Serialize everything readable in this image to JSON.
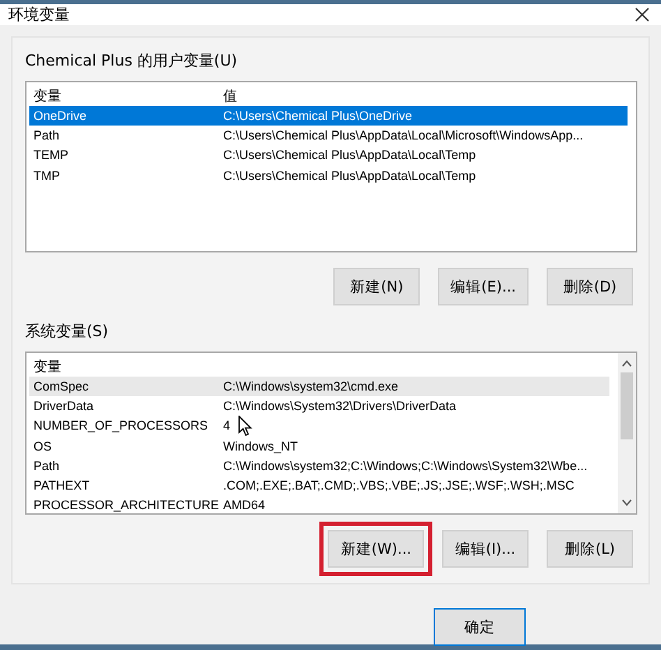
{
  "window": {
    "title": "环境变量"
  },
  "user_variables": {
    "label": "Chemical Plus 的用户变量(U)",
    "columns": [
      "变量",
      "值"
    ],
    "rows": [
      {
        "name": "OneDrive",
        "value": "C:\\Users\\Chemical Plus\\OneDrive",
        "selected": true,
        "hovered": false
      },
      {
        "name": "Path",
        "value": "C:\\Users\\Chemical Plus\\AppData\\Local\\Microsoft\\WindowsApp...",
        "selected": false,
        "hovered": false
      },
      {
        "name": "TEMP",
        "value": "C:\\Users\\Chemical Plus\\AppData\\Local\\Temp",
        "selected": false,
        "hovered": false
      },
      {
        "name": "TMP",
        "value": "C:\\Users\\Chemical Plus\\AppData\\Local\\Temp",
        "selected": false,
        "hovered": false
      }
    ],
    "buttons": [
      {
        "label": "新建(N)",
        "highlighted": false
      },
      {
        "label": "编辑(E)...",
        "highlighted": false
      },
      {
        "label": "删除(D)",
        "highlighted": false
      }
    ]
  },
  "system_variables": {
    "label": "系统变量(S)",
    "columns": [
      "变量"
    ],
    "rows": [
      {
        "name": "ComSpec",
        "value": "C:\\Windows\\system32\\cmd.exe",
        "selected": false,
        "hovered": true
      },
      {
        "name": "DriverData",
        "value": "C:\\Windows\\System32\\Drivers\\DriverData",
        "selected": false,
        "hovered": false
      },
      {
        "name": "NUMBER_OF_PROCESSORS",
        "value": "4",
        "selected": false,
        "hovered": false
      },
      {
        "name": "OS",
        "value": "Windows_NT",
        "selected": false,
        "hovered": false
      },
      {
        "name": "Path",
        "value": "C:\\Windows\\system32;C:\\Windows;C:\\Windows\\System32\\Wbe...",
        "selected": false,
        "hovered": false
      },
      {
        "name": "PATHEXT",
        "value": ".COM;.EXE;.BAT;.CMD;.VBS;.VBE;.JS;.JSE;.WSF;.WSH;.MSC",
        "selected": false,
        "hovered": false
      },
      {
        "name": "PROCESSOR_ARCHITECTURE",
        "value": "AMD64",
        "selected": false,
        "hovered": false
      }
    ],
    "buttons": [
      {
        "label": "新建(W)...",
        "highlighted": true
      },
      {
        "label": "编辑(I)...",
        "highlighted": false
      },
      {
        "label": "删除(L)",
        "highlighted": false
      }
    ]
  },
  "footer": {
    "buttons": [
      "确定"
    ]
  }
}
